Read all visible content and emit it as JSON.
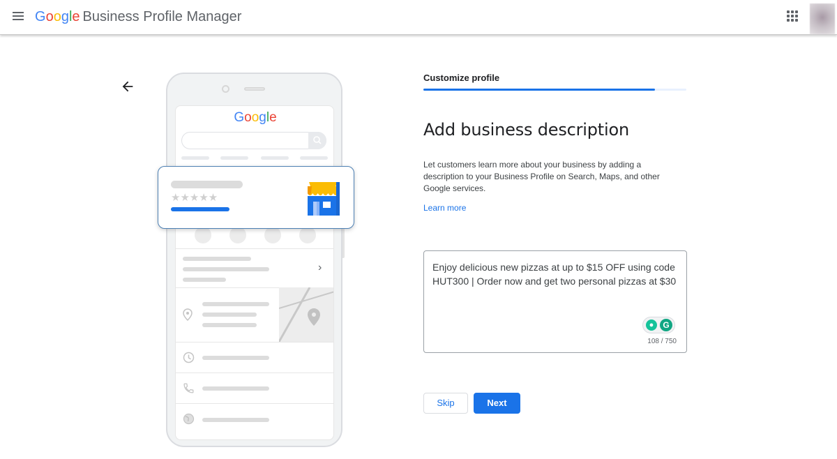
{
  "header": {
    "logo_text": "Google",
    "product_name": "Business Profile Manager",
    "icons": {
      "menu": "hamburger-menu-icon",
      "apps": "apps-grid-icon",
      "avatar": "account-avatar"
    }
  },
  "illustration": {
    "search_logo_text": "Google",
    "card_rating_stars": 5
  },
  "panel": {
    "step_label": "Customize profile",
    "progress_fraction": 0.88,
    "title": "Add business description",
    "description": "Let customers learn more about your business by adding a description to your Business Profile on Search, Maps, and other Google services.",
    "learn_more": "Learn more",
    "description_value": "Enjoy delicious new pizzas at up to $15 OFF using code HUT300 | Order now and get two personal pizzas at $30",
    "char_count": "108 / 750",
    "skip_label": "Skip",
    "next_label": "Next"
  },
  "colors": {
    "accent": "#1a73e8",
    "google_blue": "#4285F4",
    "google_red": "#EA4335",
    "google_yellow": "#FBBC05",
    "google_green": "#34A853",
    "grammarly": "#15c39a"
  }
}
